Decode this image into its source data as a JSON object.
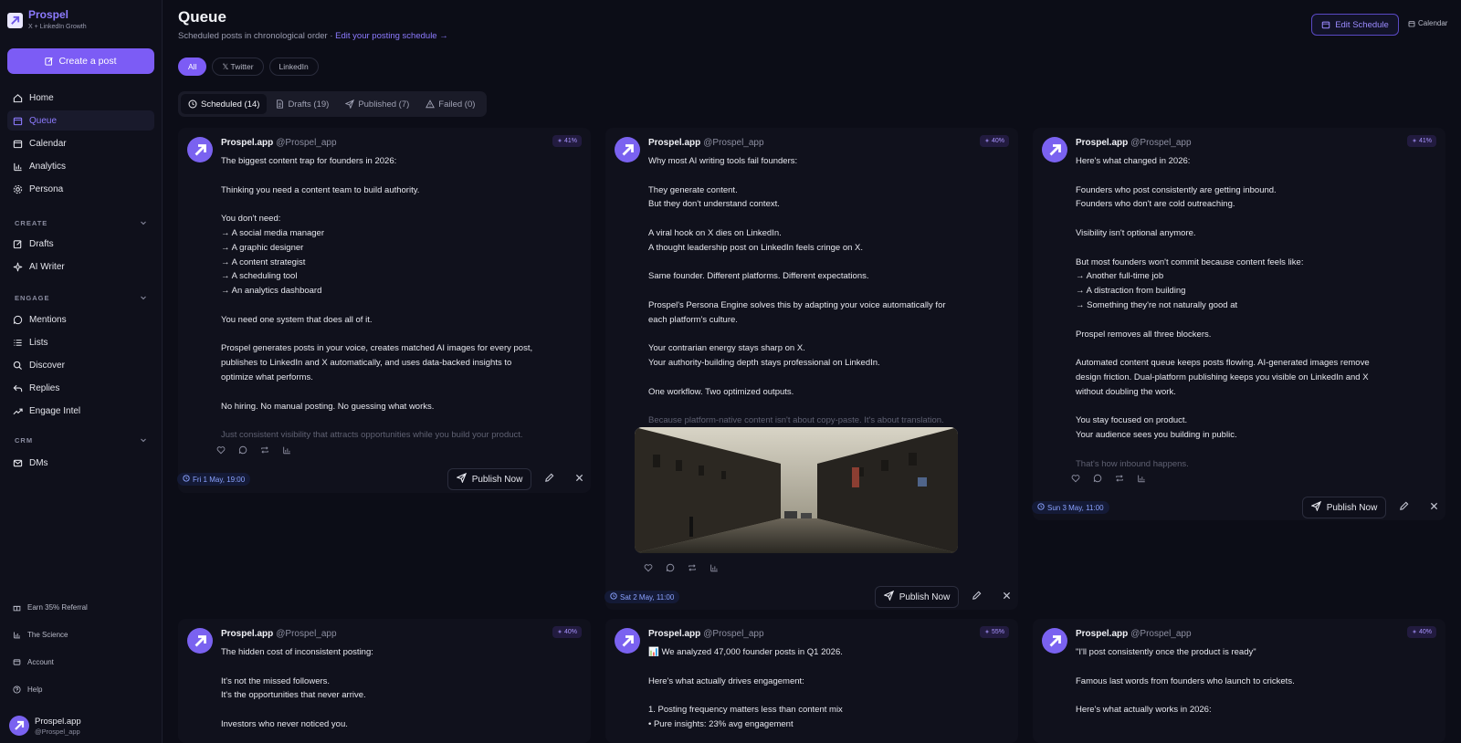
{
  "brand": {
    "name": "Prospel",
    "tagline": "X + LinkedIn Growth"
  },
  "sidebar": {
    "create_label": "Create a post",
    "main_items": [
      {
        "label": "Home",
        "icon": "home-icon"
      },
      {
        "label": "Queue",
        "icon": "calendar-icon",
        "active": true
      },
      {
        "label": "Calendar",
        "icon": "calendar-icon"
      },
      {
        "label": "Analytics",
        "icon": "bar-chart-icon"
      },
      {
        "label": "Persona",
        "icon": "gear-icon"
      }
    ],
    "sections": {
      "create": {
        "title": "CREATE",
        "items": [
          {
            "label": "Drafts"
          },
          {
            "label": "AI Writer"
          }
        ]
      },
      "engage": {
        "title": "ENGAGE",
        "items": [
          {
            "label": "Mentions"
          },
          {
            "label": "Lists"
          },
          {
            "label": "Discover"
          },
          {
            "label": "Replies"
          },
          {
            "label": "Engage Intel"
          }
        ]
      },
      "crm": {
        "title": "CRM",
        "items": [
          {
            "label": "DMs"
          }
        ]
      }
    },
    "footer_items": [
      {
        "label": "Earn 35% Referral"
      },
      {
        "label": "The Science"
      },
      {
        "label": "Account"
      },
      {
        "label": "Help"
      }
    ],
    "user": {
      "name": "Prospel.app",
      "handle": "@Prospel_app"
    }
  },
  "header": {
    "title": "Queue",
    "subtitle": "Scheduled posts in chronological order · ",
    "schedule_link": "Edit your posting schedule →",
    "edit_schedule": "Edit Schedule",
    "calendar": "Calendar"
  },
  "filters": [
    "All",
    "𝕏 Twitter",
    "LinkedIn"
  ],
  "tabs": [
    "Scheduled (14)",
    "Drafts (19)",
    "Published (7)",
    "Failed (0)"
  ],
  "publish_label": "Publish Now",
  "posts": [
    {
      "name": "Prospel.app",
      "handle": "@Prospel_app",
      "score": "41%",
      "date": "Fri 1 May, 19:00",
      "lines": [
        "The biggest content trap for founders in 2026:",
        "",
        "Thinking you need a content team to build authority.",
        "",
        "You don't need:",
        "→ A social media manager",
        "→ A graphic designer",
        "→ A content strategist",
        "→ A scheduling tool",
        "→ An analytics dashboard",
        "",
        "You need one system that does all of it.",
        "",
        "Prospel generates posts in your voice, creates matched AI images for every post,",
        "publishes to LinkedIn and X automatically, and uses data-backed insights to",
        "optimize what performs.",
        "",
        "No hiring. No manual posting. No guessing what works.",
        ""
      ],
      "fade": "Just consistent visibility that attracts opportunities while you build your product."
    },
    {
      "name": "Prospel.app",
      "handle": "@Prospel_app",
      "score": "40%",
      "date": "Sat 2 May, 11:00",
      "lines": [
        "Why most AI writing tools fail founders:",
        "",
        "They generate content.",
        "But they don't understand context.",
        "",
        "A viral hook on X dies on LinkedIn.",
        "A thought leadership post on LinkedIn feels cringe on X.",
        "",
        "Same founder. Different platforms. Different expectations.",
        "",
        "Prospel's Persona Engine solves this by adapting your voice automatically for",
        "each platform's culture.",
        "",
        "Your contrarian energy stays sharp on X.",
        "Your authority-building depth stays professional on LinkedIn.",
        "",
        "One workflow. Two optimized outputs.",
        ""
      ],
      "fade": "Because platform-native content isn't about copy-paste. It's about translation."
    },
    {
      "name": "Prospel.app",
      "handle": "@Prospel_app",
      "score": "41%",
      "date": "Sun 3 May, 11:00",
      "lines": [
        "Here's what changed in 2026:",
        "",
        "Founders who post consistently are getting inbound.",
        "Founders who don't are cold outreaching.",
        "",
        "Visibility isn't optional anymore.",
        "",
        "But most founders won't commit because content feels like:",
        "→ Another full-time job",
        "→ A distraction from building",
        "→ Something they're not naturally good at",
        "",
        "Prospel removes all three blockers.",
        "",
        "Automated content queue keeps posts flowing. AI-generated images remove",
        "design friction. Dual-platform publishing keeps you visible on LinkedIn and X",
        "without doubling the work.",
        "",
        "You stay focused on product.",
        "Your audience sees you building in public.",
        ""
      ],
      "fade": "That's how inbound happens."
    },
    {
      "name": "Prospel.app",
      "handle": "@Prospel_app",
      "score": "40%",
      "lines": [
        "The hidden cost of inconsistent posting:",
        "",
        "It's not the missed followers.",
        "It's the opportunities that never arrive.",
        "",
        "Investors who never noticed you."
      ]
    },
    {
      "name": "Prospel.app",
      "handle": "@Prospel_app",
      "score": "55%",
      "lines": [
        "📊 We analyzed 47,000 founder posts in Q1 2026.",
        "",
        "Here's what actually drives engagement:",
        "",
        "1. Posting frequency matters less than content mix",
        "• Pure insights: 23% avg engagement"
      ]
    },
    {
      "name": "Prospel.app",
      "handle": "@Prospel_app",
      "score": "40%",
      "lines": [
        "\"I'll post consistently once the product is ready\"",
        "",
        "Famous last words from founders who launch to crickets.",
        "",
        "Here's what actually works in 2026:"
      ]
    }
  ]
}
